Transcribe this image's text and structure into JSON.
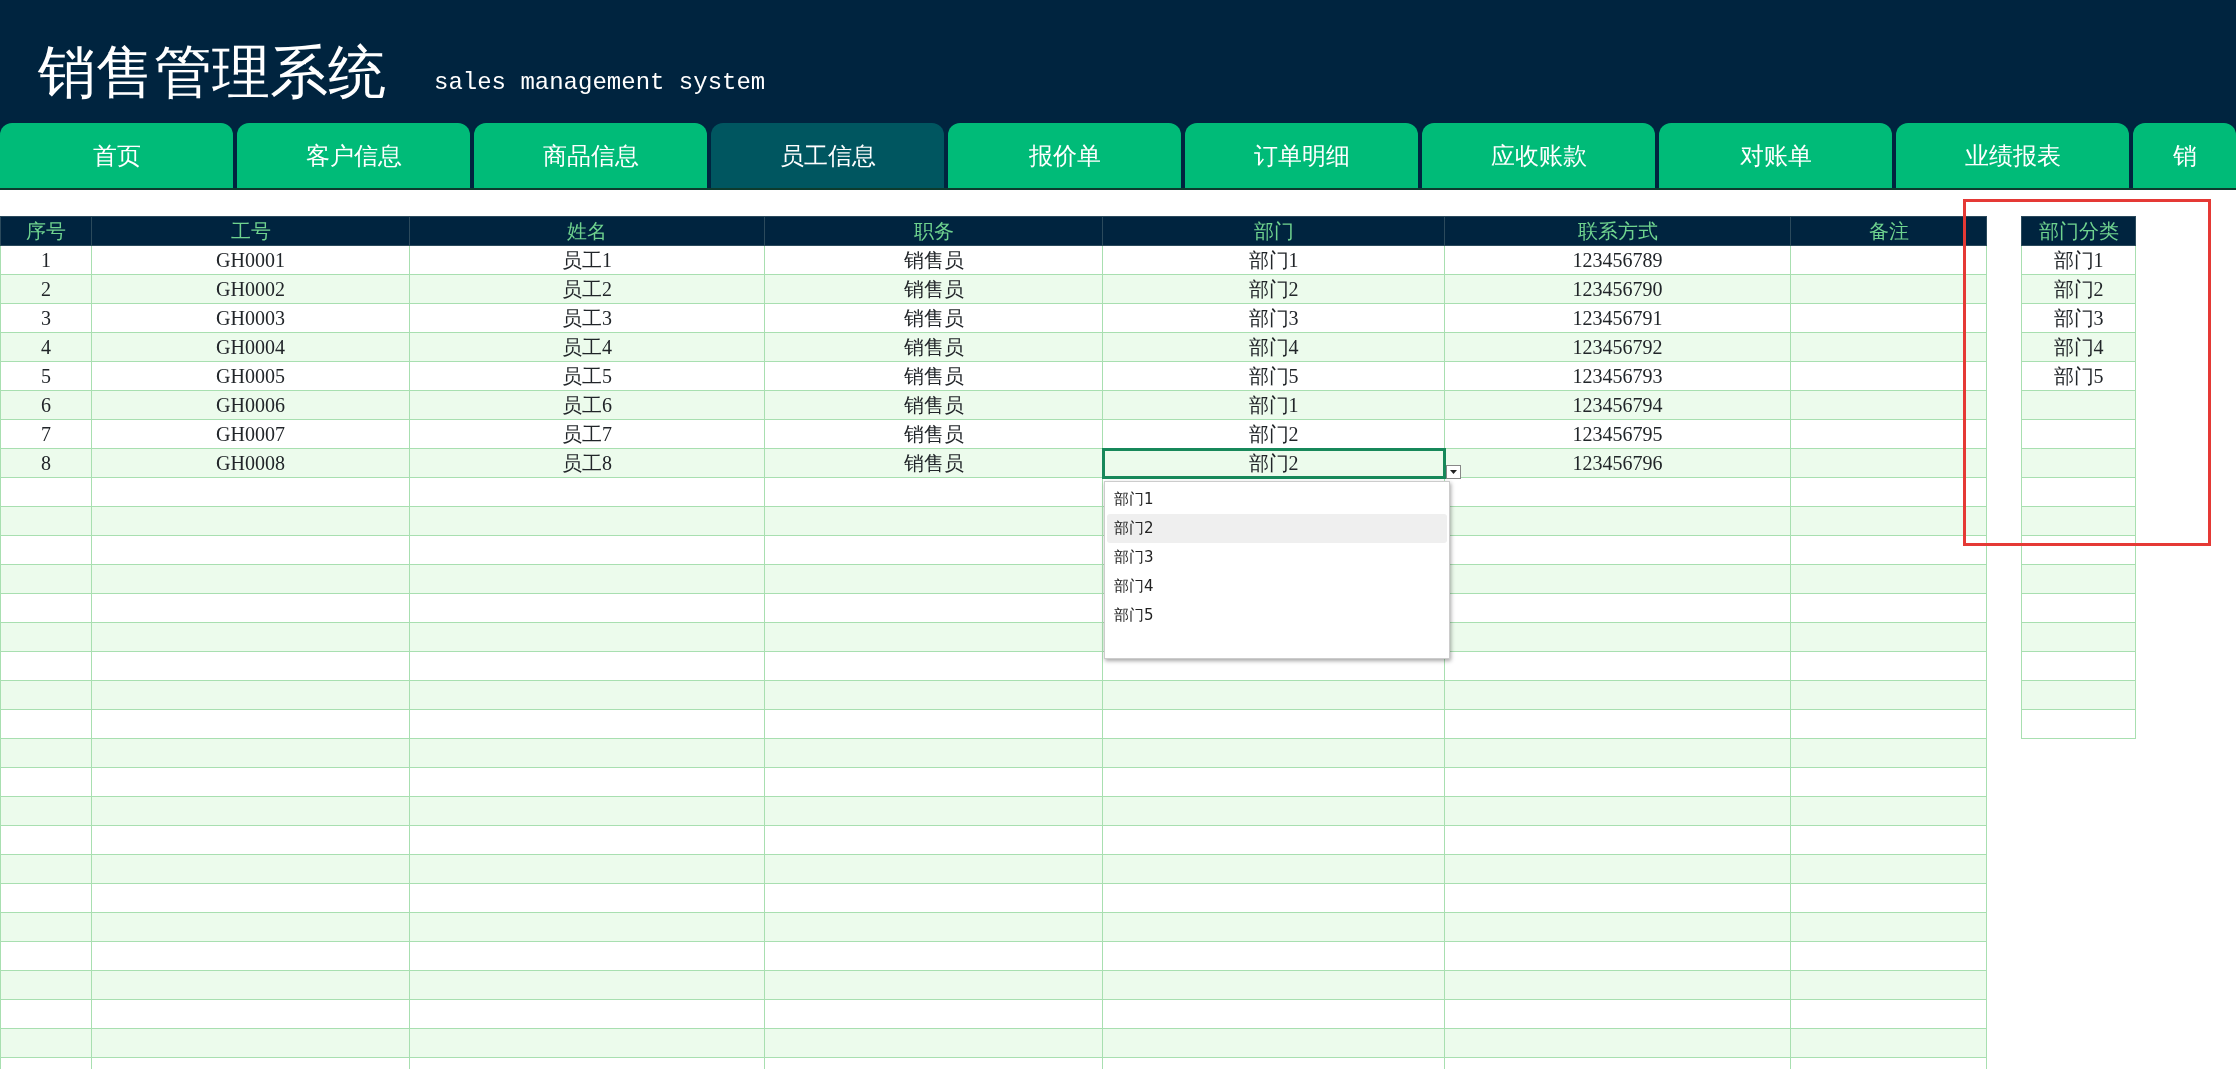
{
  "header": {
    "title": "销售管理系统",
    "subtitle": "sales management system"
  },
  "tabs": [
    {
      "label": "首页",
      "selected": false
    },
    {
      "label": "客户信息",
      "selected": false
    },
    {
      "label": "商品信息",
      "selected": false
    },
    {
      "label": "员工信息",
      "selected": true
    },
    {
      "label": "报价单",
      "selected": false
    },
    {
      "label": "订单明细",
      "selected": false
    },
    {
      "label": "应收账款",
      "selected": false
    },
    {
      "label": "对账单",
      "selected": false
    },
    {
      "label": "业绩报表",
      "selected": false
    },
    {
      "label": "销",
      "selected": false
    }
  ],
  "employee_table": {
    "columns": [
      "序号",
      "工号",
      "姓名",
      "职务",
      "部门",
      "联系方式",
      "备注"
    ],
    "rows": [
      {
        "no": "1",
        "id": "GH0001",
        "name": "员工1",
        "role": "销售员",
        "dept": "部门1",
        "contact": "123456789",
        "dept_selected": false
      },
      {
        "no": "2",
        "id": "GH0002",
        "name": "员工2",
        "role": "销售员",
        "dept": "部门2",
        "contact": "123456790",
        "dept_selected": false
      },
      {
        "no": "3",
        "id": "GH0003",
        "name": "员工3",
        "role": "销售员",
        "dept": "部门3",
        "contact": "123456791",
        "dept_selected": false
      },
      {
        "no": "4",
        "id": "GH0004",
        "name": "员工4",
        "role": "销售员",
        "dept": "部门4",
        "contact": "123456792",
        "dept_selected": false
      },
      {
        "no": "5",
        "id": "GH0005",
        "name": "员工5",
        "role": "销售员",
        "dept": "部门5",
        "contact": "123456793",
        "dept_selected": false
      },
      {
        "no": "6",
        "id": "GH0006",
        "name": "员工6",
        "role": "销售员",
        "dept": "部门1",
        "contact": "123456794",
        "dept_selected": false
      },
      {
        "no": "7",
        "id": "GH0007",
        "name": "员工7",
        "role": "销售员",
        "dept": "部门2",
        "contact": "123456795",
        "dept_selected": false
      },
      {
        "no": "8",
        "id": "GH0008",
        "name": "员工8",
        "role": "销售员",
        "dept": "部门2",
        "contact": "123456796",
        "dept_selected": true
      }
    ]
  },
  "dropdown": {
    "options": [
      {
        "label": "部门1",
        "highlighted": false
      },
      {
        "label": "部门2",
        "highlighted": true
      },
      {
        "label": "部门3",
        "highlighted": false
      },
      {
        "label": "部门4",
        "highlighted": false
      },
      {
        "label": "部门5",
        "highlighted": false
      }
    ]
  },
  "category_table": {
    "header": "部门分类",
    "items": [
      "部门1",
      "部门2",
      "部门3",
      "部门4",
      "部门5"
    ]
  }
}
